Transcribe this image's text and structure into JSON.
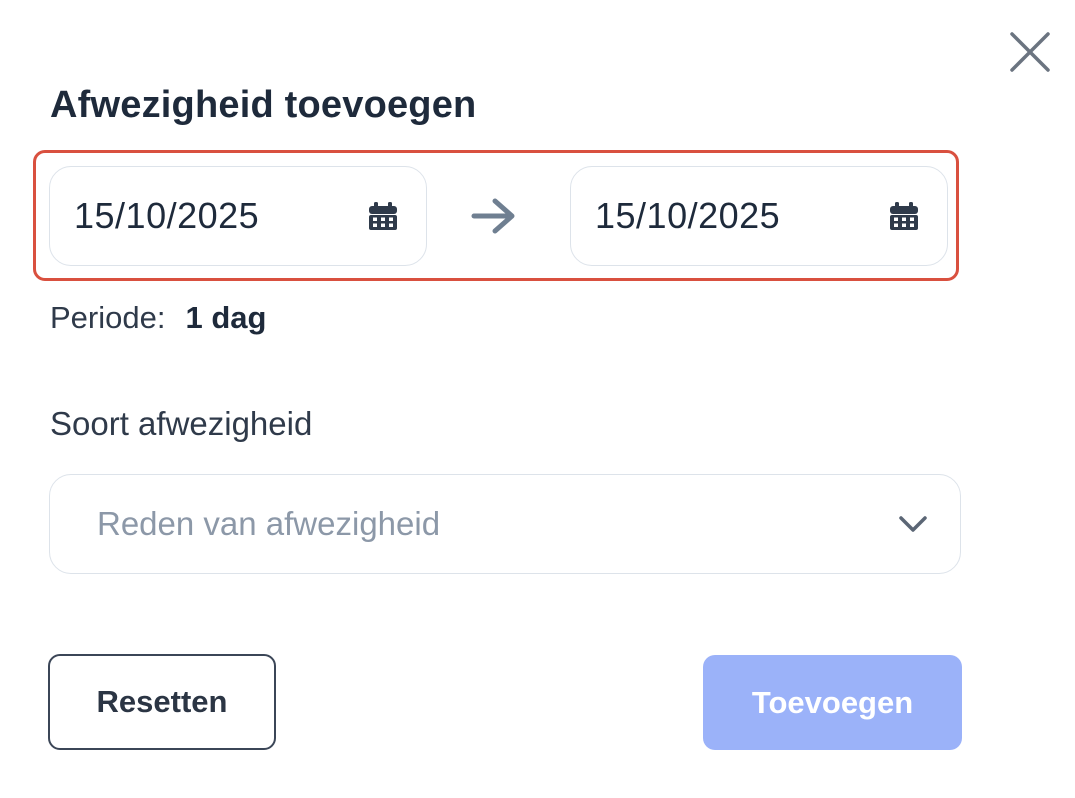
{
  "dialog": {
    "title": "Afwezigheid toevoegen",
    "close_icon": "close-icon"
  },
  "date_range": {
    "start_date": "15/10/2025",
    "end_date": "15/10/2025",
    "calendar_icon": "calendar-icon",
    "separator_icon": "arrow-right-icon",
    "highlight_color": "#d9503f"
  },
  "period": {
    "label": "Periode:",
    "value": "1 dag"
  },
  "absence_type": {
    "label": "Soort afwezigheid",
    "placeholder": "Reden van afwezigheid",
    "dropdown_icon": "chevron-down-icon"
  },
  "actions": {
    "reset_label": "Resetten",
    "add_label": "Toevoegen",
    "add_disabled": true,
    "add_color": "#9bb2f9"
  }
}
